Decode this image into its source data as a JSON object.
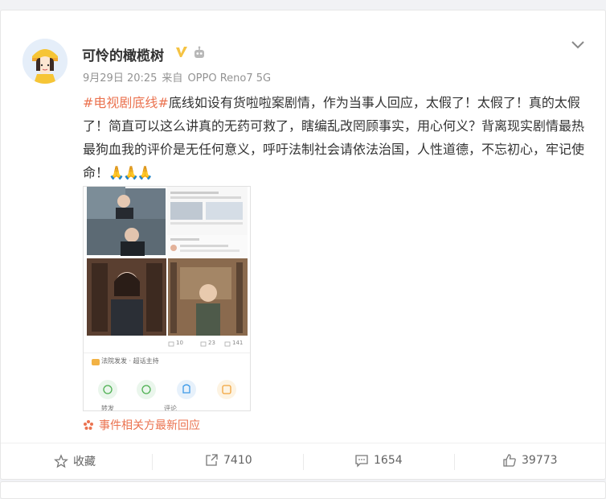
{
  "post": {
    "author": "可怜的橄榄树",
    "time": "9月29日 20:25",
    "source_prefix": "来自",
    "device": "OPPO Reno7 5G",
    "hashtag": "#电视剧底线#",
    "body": "底线如设有货啦啦案剧情，作为当事人回应，太假了！太假了！真的太假了！简直可以这么讲真的无药可救了，瞎编乱改罔顾事实，用心何义？背离现实剧情最热最狗血我的评价是无任何意义，呼吁法制社会请依法治国，人性道德，不忘初心，牢记使命！",
    "emoji": "🙏🙏🙏",
    "event_link": "事件相关方最新回应"
  },
  "screenshot": {
    "stat_likes": "10",
    "stat_comments": "23",
    "stat_reposts": "141",
    "account": "法院发发 · 超话主持",
    "bottom_repost": "转发",
    "bottom_comment": "评论"
  },
  "actions": {
    "favorite": "收藏",
    "repost": "7410",
    "comment": "1654",
    "like": "39773"
  },
  "colors": {
    "accent": "#eb7350",
    "vip": "#f5c343"
  }
}
